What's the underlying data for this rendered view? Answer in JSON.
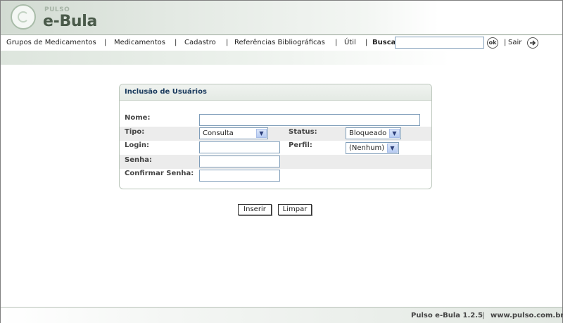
{
  "logo": {
    "small": "PULSO",
    "name": "e-Bula"
  },
  "menu": {
    "items": [
      "Grupos de Medicamentos",
      "Medicamentos",
      "Cadastro",
      "Referências Bibliográficas",
      "Útil"
    ],
    "separator": "|",
    "search_label": "Busca",
    "search_value": "",
    "ok_label": "ok",
    "logout_label": "Sair",
    "logout_icon": "arrow-right-icon"
  },
  "form": {
    "title": "Inclusão  de Usuários",
    "nome": {
      "label": "Nome:",
      "value": ""
    },
    "tipo": {
      "label": "Tipo:",
      "selected": "Consulta"
    },
    "status": {
      "label": "Status:",
      "selected": "Bloqueado"
    },
    "login": {
      "label": "Login:",
      "value": ""
    },
    "perfil": {
      "label": "Perfil:",
      "selected": "(Nenhum)"
    },
    "senha": {
      "label": "Senha:",
      "value": ""
    },
    "confirmar": {
      "label": "Confirmar Senha:",
      "value": ""
    }
  },
  "buttons": {
    "insert": "Inserir",
    "clear": "Limpar"
  },
  "footer": {
    "version": "Pulso e-Bula 1.2.5",
    "separator": "|",
    "site": "www.pulso.com.br"
  }
}
